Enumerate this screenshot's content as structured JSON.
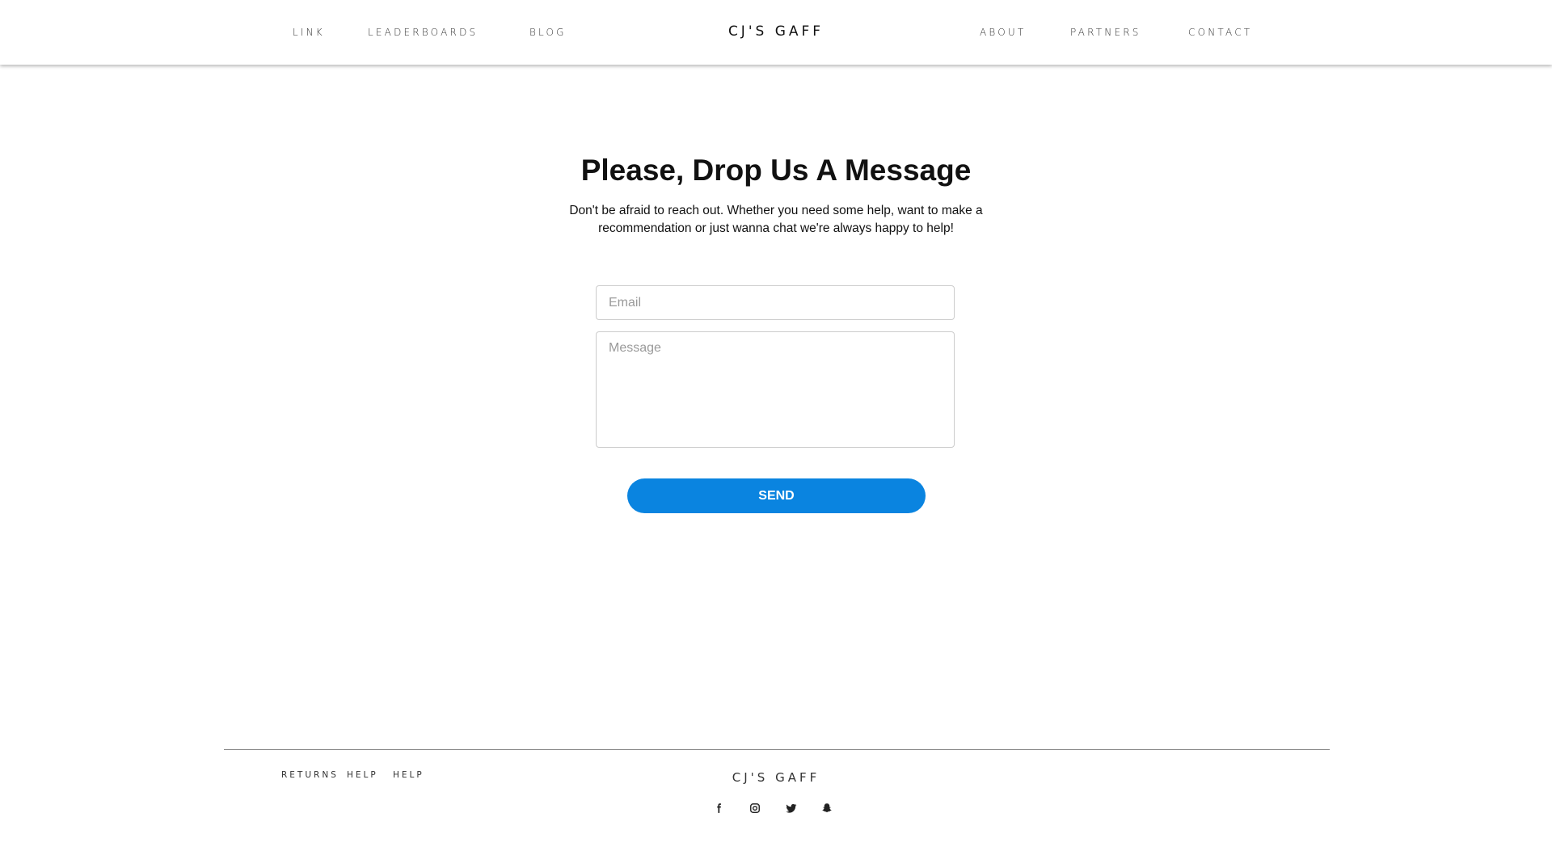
{
  "header": {
    "brand": "CJ'S GAFF",
    "nav_left": [
      "LINK",
      "LEADERBOARDS",
      "BLOG"
    ],
    "nav_right": [
      "ABOUT",
      "PARTNERS",
      "CONTACT"
    ]
  },
  "main": {
    "heading": "Please, Drop Us A Message",
    "intro": "Don't be afraid to reach out. Whether you need some help, want to make a recommendation or just wanna chat we're always happy to help!",
    "email_placeholder": "Email",
    "message_placeholder": "Message",
    "send_label": "SEND"
  },
  "footer": {
    "links": [
      "RETURNS",
      "HELP",
      "HELP"
    ],
    "brand": "CJ'S GAFF",
    "social_icons": [
      "facebook-icon",
      "instagram-icon",
      "twitter-icon",
      "snapchat-icon"
    ]
  },
  "colors": {
    "accent": "#0a84e0",
    "text": "#111111"
  }
}
